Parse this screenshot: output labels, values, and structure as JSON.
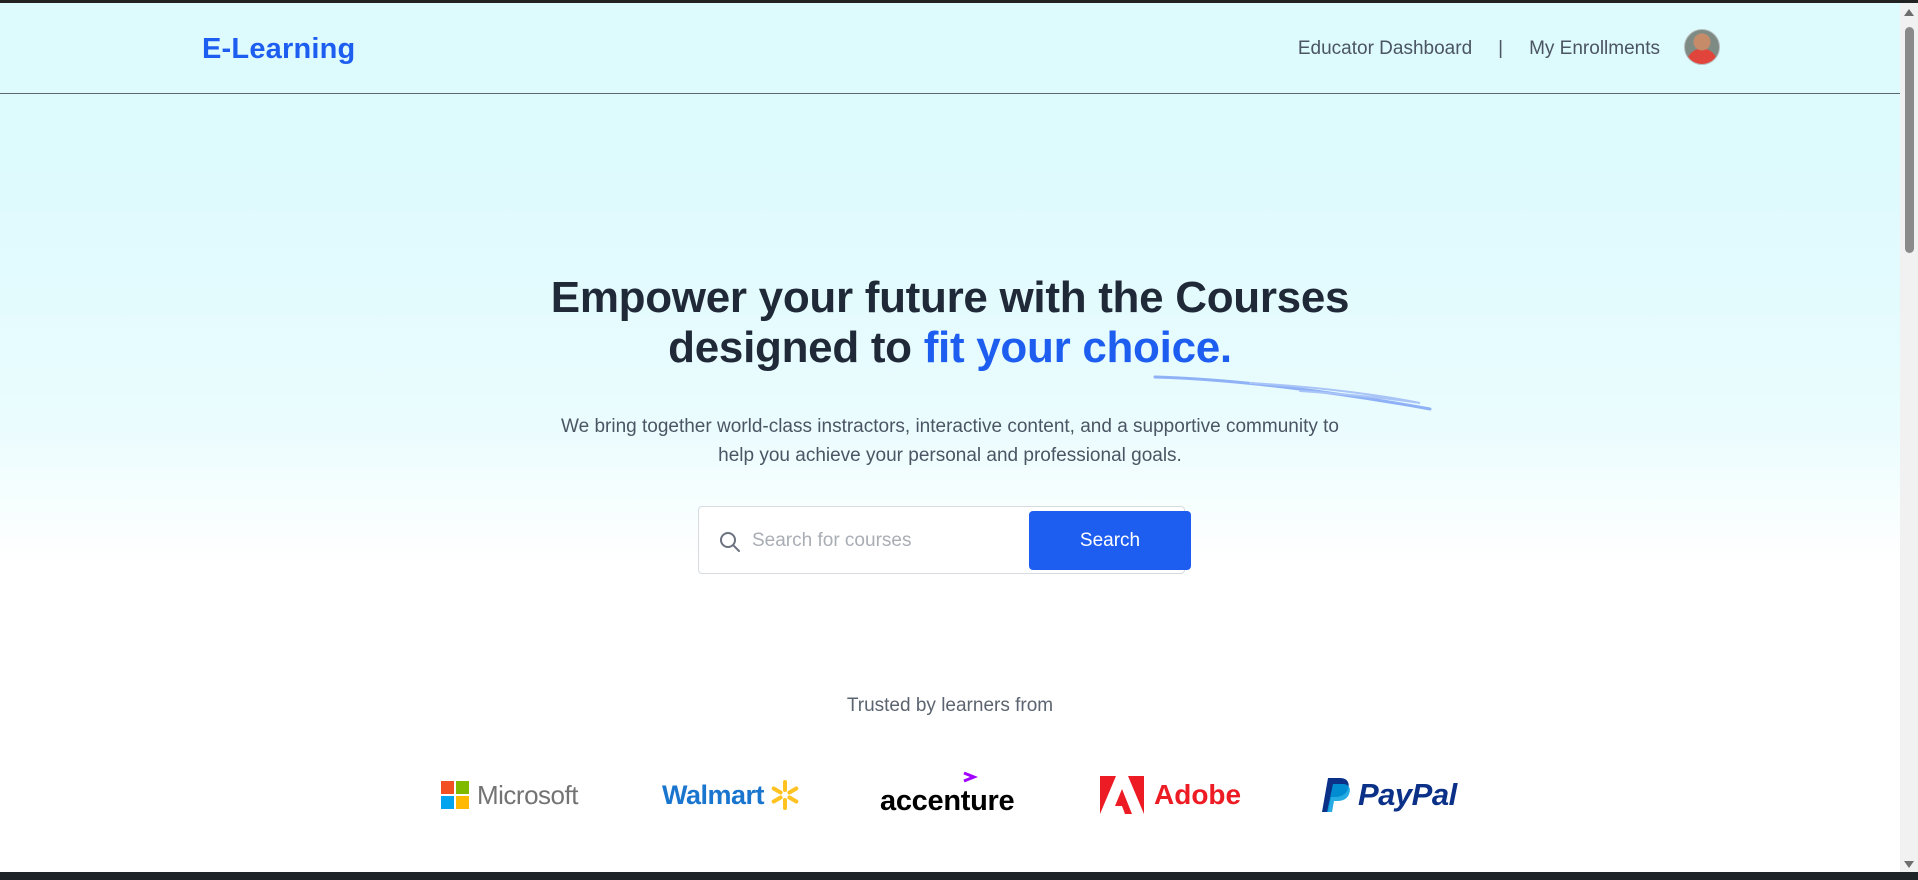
{
  "navbar": {
    "logo": "E-Learning",
    "links": [
      "Educator Dashboard",
      "My Enrollments"
    ],
    "separator": "|"
  },
  "hero": {
    "title_line1": "Empower your future with the Courses",
    "title_line2_plain": "designed to ",
    "title_line2_accent": "fit your choice.",
    "subtitle_line1": "We bring together world-class instractors, interactive content, and a supportive community to",
    "subtitle_line2": "help you achieve your personal and professional goals."
  },
  "search": {
    "placeholder": "Search for courses",
    "value": "",
    "button_label": "Search"
  },
  "trusted": {
    "heading": "Trusted by learners from",
    "companies": [
      "Microsoft",
      "Walmart",
      "accenture",
      "Adobe",
      "PayPal"
    ]
  },
  "colors": {
    "accent": "#1d5ef0",
    "heading": "#1f2937",
    "body_text": "#4b5563",
    "hero_bg": "#ddfafd"
  },
  "icons": {
    "search": "search-icon",
    "avatar": "user-avatar"
  }
}
